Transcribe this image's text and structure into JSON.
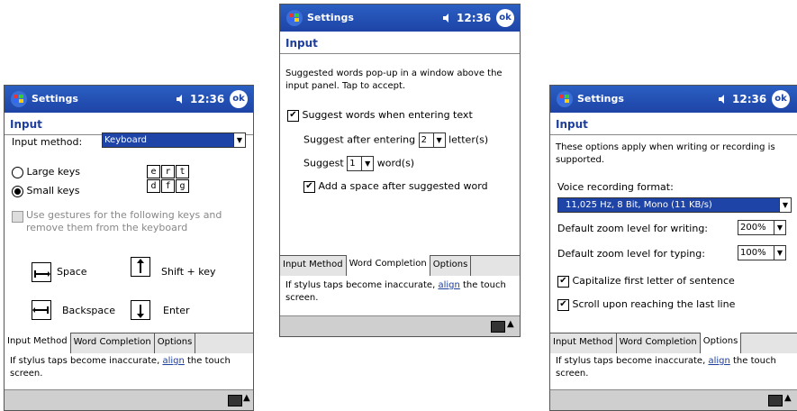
{
  "common": {
    "app_title": "Settings",
    "clock": "12:36",
    "ok_label": "ok",
    "page_title": "Input",
    "tabs": [
      "Input Method",
      "Word Completion",
      "Options"
    ],
    "note_prefix": "If stylus taps become inaccurate,",
    "note_link": "align",
    "note_suffix": "the touch screen."
  },
  "screen1": {
    "input_method_label": "Input method:",
    "input_method_value": "Keyboard",
    "large_keys": "Large keys",
    "small_keys": "Small keys",
    "key_samples_row1": [
      "e",
      "r",
      "t"
    ],
    "key_samples_row2": [
      "d",
      "f",
      "g"
    ],
    "gestures_text": "Use gestures for the following keys and remove them from the keyboard",
    "gesture_space": "Space",
    "gesture_shift": "Shift + key",
    "gesture_backspace": "Backspace",
    "gesture_enter": "Enter"
  },
  "screen2": {
    "intro": "Suggested words pop-up in a window above the input panel.  Tap to accept.",
    "suggest_words": "Suggest words when entering text",
    "suggest_after": "Suggest after entering",
    "letters_value": "2",
    "letters_unit": "letter(s)",
    "suggest_label": "Suggest",
    "words_value": "1",
    "words_unit": "word(s)",
    "add_space": "Add a space after suggested word"
  },
  "screen3": {
    "intro": "These options apply when writing or recording is supported.",
    "voice_format_label": "Voice recording format:",
    "voice_format_value": "11,025 Hz, 8 Bit, Mono (11 KB/s)",
    "zoom_writing_label": "Default zoom level for writing:",
    "zoom_writing_value": "200%",
    "zoom_typing_label": "Default zoom level for typing:",
    "zoom_typing_value": "100%",
    "capitalize": "Capitalize first letter of sentence",
    "scroll": "Scroll upon reaching the last line"
  },
  "colors": {
    "titlebar": "#1d44a6",
    "accent_text": "#1d3e9c",
    "selection": "#1d44a6"
  }
}
